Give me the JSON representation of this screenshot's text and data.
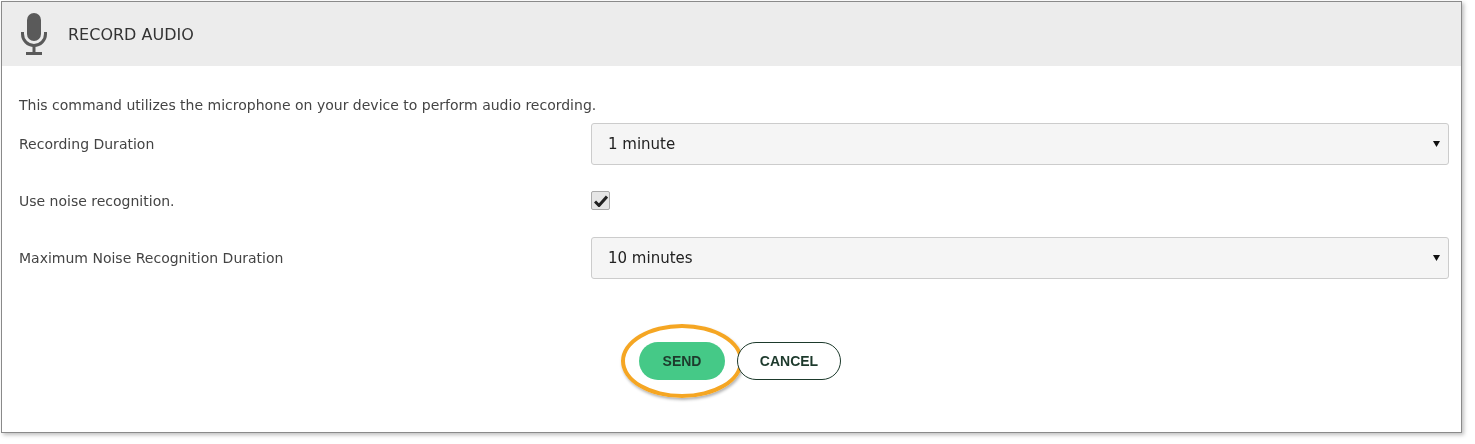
{
  "header": {
    "title": "RECORD AUDIO"
  },
  "description": "This command utilizes the microphone on your device to perform audio recording.",
  "fields": [
    {
      "kind": "select",
      "label": "Recording Duration",
      "value": "1 minute"
    },
    {
      "kind": "checkbox",
      "label": "Use noise recognition.",
      "checked": true
    },
    {
      "kind": "select",
      "label": "Maximum Noise Recognition Duration",
      "value": "10 minutes"
    }
  ],
  "buttons": [
    {
      "kind": "primary",
      "label": "SEND",
      "highlighted": true
    },
    {
      "kind": "secondary",
      "label": "CANCEL",
      "highlighted": false
    }
  ]
}
